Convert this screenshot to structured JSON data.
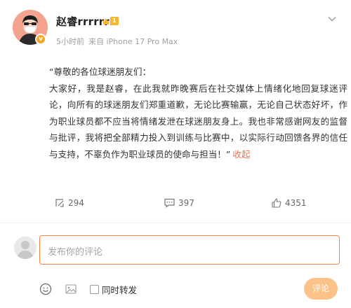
{
  "post": {
    "author": "赵睿rrrrrrr",
    "level_badge": "1",
    "meta_time": "5小时前",
    "meta_source": "来自 iPhone 17 Pro Max",
    "content": [
      "“尊敬的各位球迷朋友们：",
      "大家好，我是赵睿，在此我就昨晚赛后在社交媒体上情绪化地回复球迷评论，向所有的球迷朋友们郑重道歉，无论比赛输赢，无论自己状态好坏，作为职业球员都不应当将情绪发泄在球迷朋友身上。我也非常感谢网友的监督与批评，我将把全部精力投入到训练与比赛中，以实际行动回馈各界的信任与支持，不辜负作为职业球员的使命与担当！”"
    ],
    "collapse_label": "收起",
    "repost_count": "294",
    "comment_count": "397",
    "like_count": "4351"
  },
  "composer": {
    "placeholder": "发布你的评论",
    "also_repost_label": "同时转发",
    "submit_label": "评论"
  },
  "icons": {
    "more": "chevron-down-icon",
    "repost": "repost-icon",
    "comment": "comment-icon",
    "like": "thumbs-up-icon",
    "emoji": "emoji-icon",
    "image": "image-icon",
    "verified": "verified-badge-icon"
  },
  "colors": {
    "accent": "#eb7350",
    "input_border": "#ff8140",
    "submit_bg": "#fdc287",
    "level_badge": "#f7b72c",
    "verified": "#f6a623"
  }
}
